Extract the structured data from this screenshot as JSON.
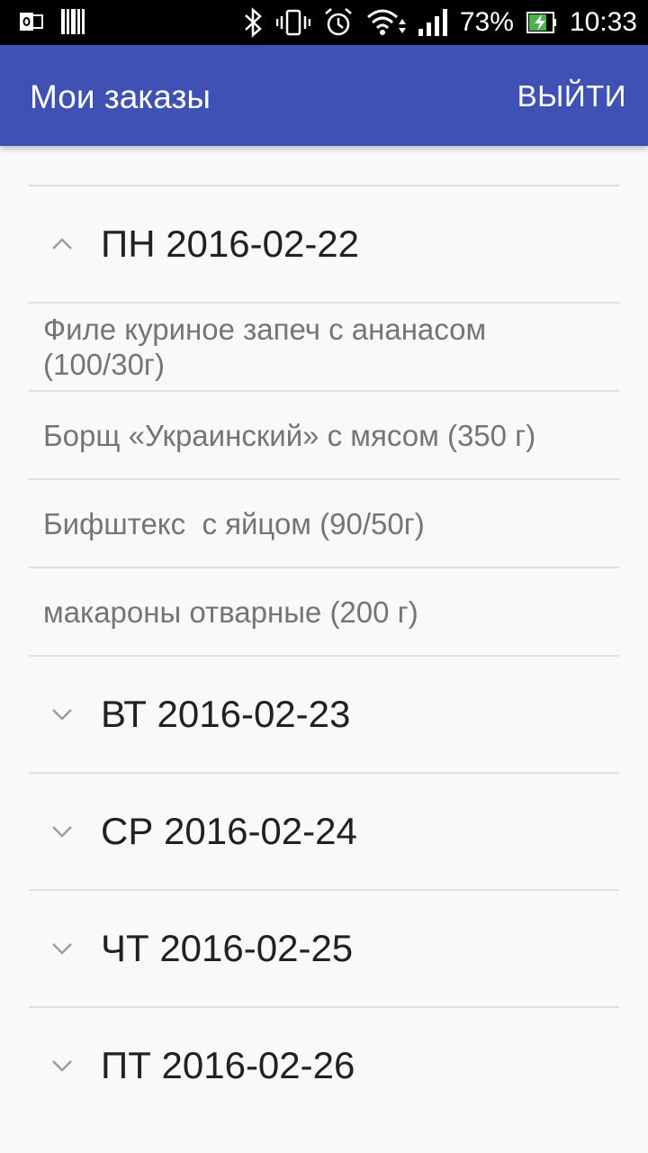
{
  "status_bar": {
    "battery": "73%",
    "time": "10:33"
  },
  "appbar": {
    "title": "Мои заказы",
    "logout_label": "ВЫЙТИ"
  },
  "orders": {
    "days": [
      {
        "label": "ПН 2016-02-22",
        "expanded": true,
        "items": [
          "Филе куриное запеч с ананасом (100/30г)",
          "Борщ «Украинский» с мясом (350 г)",
          "Бифштекс  с яйцом (90/50г)",
          "макароны отварные (200 г)"
        ]
      },
      {
        "label": "ВТ 2016-02-23",
        "expanded": false
      },
      {
        "label": "СР 2016-02-24",
        "expanded": false
      },
      {
        "label": "ЧТ 2016-02-25",
        "expanded": false
      },
      {
        "label": "ПТ 2016-02-26",
        "expanded": false
      }
    ]
  },
  "colors": {
    "primary": "#3f51b5",
    "background": "#f9f9f9",
    "divider": "#e0e0e0"
  }
}
